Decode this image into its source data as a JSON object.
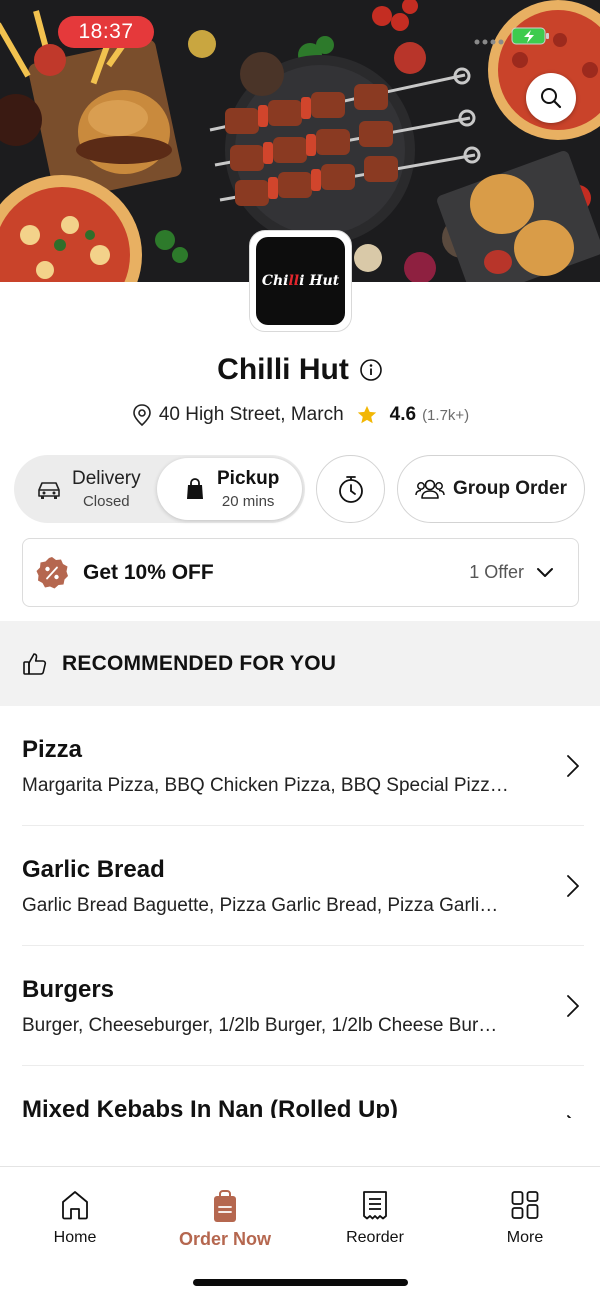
{
  "status_bar": {
    "time": "18:37"
  },
  "restaurant": {
    "logo_text_1": "Chi",
    "logo_text_red": "ll",
    "logo_text_2": "i Hut",
    "name": "Chilli Hut",
    "address": "40 High Street, March",
    "rating": "4.6",
    "rating_count": "(1.7k+)"
  },
  "modes": {
    "delivery": {
      "label": "Delivery",
      "status": "Closed"
    },
    "pickup": {
      "label": "Pickup",
      "time": "20 mins"
    }
  },
  "group_order_label": "Group Order",
  "offer": {
    "title": "Get 10% OFF",
    "count": "1 Offer"
  },
  "recommended_title": "RECOMMENDED FOR YOU",
  "menu": [
    {
      "name": "Pizza",
      "items": "Margarita Pizza, BBQ Chicken Pizza, BBQ Special Pizz…"
    },
    {
      "name": "Garlic Bread",
      "items": "Garlic Bread Baguette, Pizza Garlic Bread, Pizza Garli…"
    },
    {
      "name": "Burgers",
      "items": "Burger, Cheeseburger, 1/2lb Burger, 1/2lb Cheese Bur…"
    },
    {
      "name": "Mixed Kebabs In Nan (Rolled Up)",
      "items": ""
    }
  ],
  "nav": [
    {
      "label": "Home",
      "icon": "home-icon"
    },
    {
      "label": "Order Now",
      "icon": "order-bag-icon"
    },
    {
      "label": "Reorder",
      "icon": "receipt-icon"
    },
    {
      "label": "More",
      "icon": "grid-icon"
    }
  ],
  "colors": {
    "accent": "#b5674f",
    "status_pill": "#e5393b",
    "star": "#f2b705",
    "battery": "#3ecb4e"
  }
}
